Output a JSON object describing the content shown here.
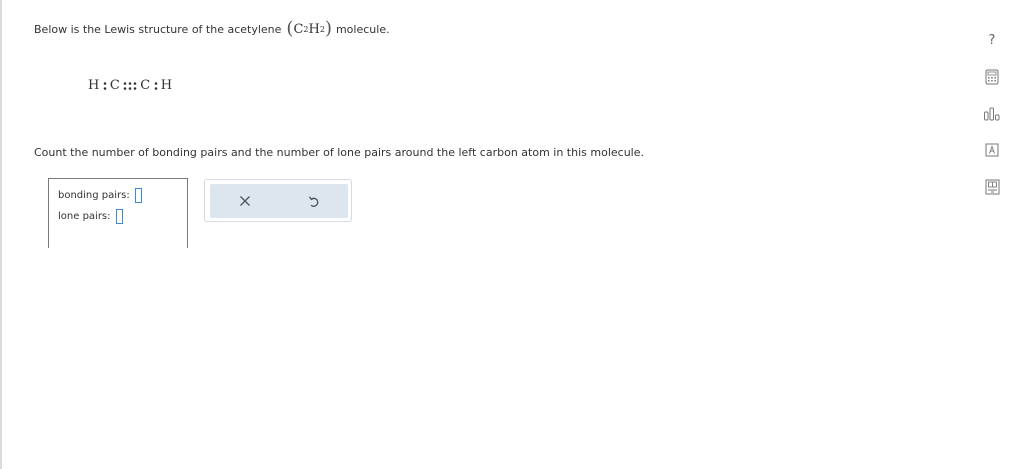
{
  "question": {
    "intro_before": "Below is the Lewis structure of the acetylene",
    "formula": {
      "open": "(",
      "c": "C",
      "c_sub": "2",
      "h": "H",
      "h_sub": "2",
      "close": ")"
    },
    "intro_after": "molecule.",
    "lewis": {
      "h1": "H",
      "c1": "C",
      "c2": "C",
      "h2": "H"
    },
    "prompt": "Count the number of bonding pairs and the number of lone pairs around the left carbon atom in this molecule."
  },
  "answer": {
    "bonding_label": "bonding pairs:",
    "bonding_value": "",
    "lone_label": "lone pairs:",
    "lone_value": ""
  },
  "actions": {
    "clear_icon": "close-icon",
    "undo_icon": "undo-icon"
  },
  "tools": [
    {
      "name": "help-icon",
      "glyph": "?"
    },
    {
      "name": "calculator-icon"
    },
    {
      "name": "data-chart-icon"
    },
    {
      "name": "periodic-table-icon"
    },
    {
      "name": "ereader-icon"
    }
  ]
}
